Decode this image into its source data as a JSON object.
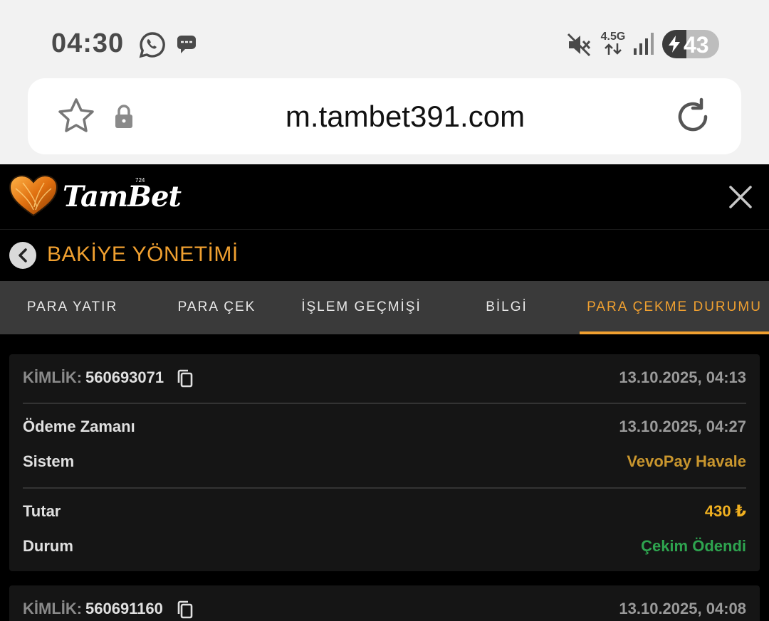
{
  "status_bar": {
    "time": "04:30",
    "network_type": "4.5G",
    "battery_level": "43",
    "icons": [
      "whatsapp-icon",
      "message-icon",
      "mute-icon",
      "signal-icon",
      "battery-charging-icon"
    ]
  },
  "browser": {
    "url": "m.tambet391.com",
    "icons": [
      "star-icon",
      "lock-icon",
      "reload-icon"
    ]
  },
  "app": {
    "logo_text": "TamBet",
    "logo_sup": "724",
    "page_title": "BAKİYE YÖNETİMİ",
    "tabs": [
      {
        "label": "PARA YATIR",
        "active": false
      },
      {
        "label": "PARA ÇEK",
        "active": false
      },
      {
        "label": "İŞLEM GEÇMİŞİ",
        "active": false
      },
      {
        "label": "BİLGİ",
        "active": false
      },
      {
        "label": "PARA ÇEKME DURUMU",
        "active": true
      }
    ],
    "accent_color": "#f0a030"
  },
  "transactions": [
    {
      "id_label": "KİMLİK:",
      "id": "560693071",
      "created": "13.10.2025, 04:13",
      "payment_time_label": "Ödeme Zamanı",
      "payment_time": "13.10.2025, 04:27",
      "system_label": "Sistem",
      "system": "VevoPay Havale",
      "amount_label": "Tutar",
      "amount": "430 ₺",
      "status_label": "Durum",
      "status": "Çekim Ödendi"
    },
    {
      "id_label": "KİMLİK:",
      "id": "560691160",
      "created": "13.10.2025, 04:08"
    }
  ]
}
